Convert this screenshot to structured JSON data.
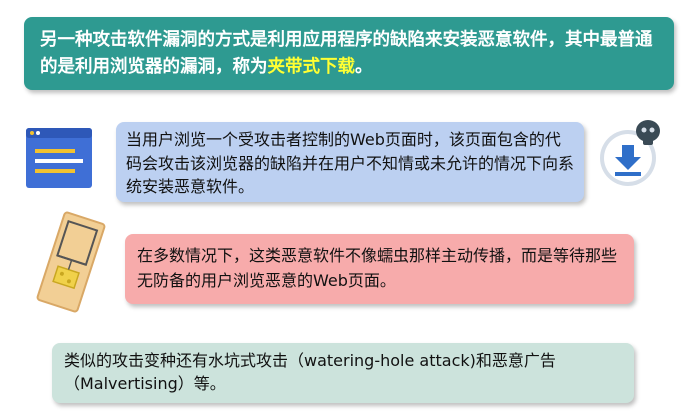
{
  "intro": {
    "text_before": "另一种攻击软件漏洞的方式是利用应用程序的缺陷来安装恶意软件，其中最普通的是利用浏览器的漏洞，称为",
    "highlight": "夹带式下载",
    "text_after": "。"
  },
  "description": "当用户浏览一个受攻击者控制的Web页面时，该页面包含的代码会攻击该浏览器的缺陷并在用户不知情或未允许的情况下向系统安装恶意软件。",
  "passive_note": "在多数情况下，这类恶意软件不像蠕虫那样主动传播，而是等待那些无防备的用户浏览恶意的Web页面。",
  "variants": "类似的攻击变种还有水坑式攻击（watering-hole attack)和恶意广告（Malvertising）等。",
  "icons": {
    "browser": "browser-window-icon",
    "download": "download-skull-icon",
    "trap": "mousetrap-icon"
  },
  "colors": {
    "title_bg": "#2e9a91",
    "highlight": "#ffff33",
    "blue_box": "#bcd0f1",
    "pink_box": "#f7abab",
    "green_box": "#cce3dc"
  }
}
